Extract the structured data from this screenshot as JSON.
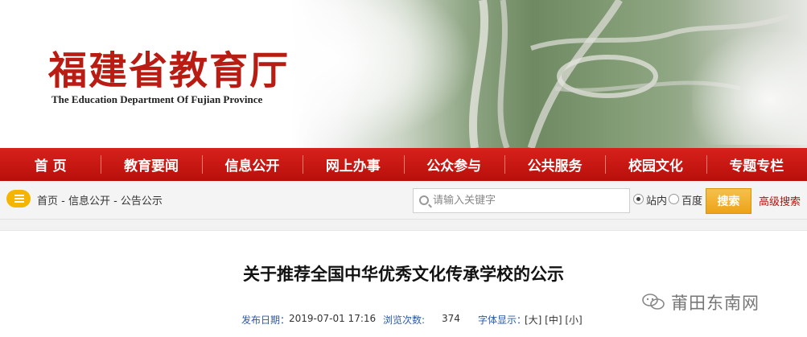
{
  "header": {
    "logo_cn": "福建省教育厅",
    "logo_en": "The Education Department Of Fujian Province"
  },
  "nav": {
    "items": [
      "首 页",
      "教育要闻",
      "信息公开",
      "网上办事",
      "公众参与",
      "公共服务",
      "校园文化",
      "专题专栏"
    ]
  },
  "breadcrumb": {
    "text": "首页 - 信息公开 - 公告公示"
  },
  "search": {
    "placeholder": "请输入关键字",
    "value": "",
    "option_site": "站内",
    "option_baidu": "百度",
    "selected": "站内",
    "button": "搜索",
    "advanced": "高级搜索"
  },
  "article": {
    "title": "关于推荐全国中华优秀文化传承学校的公示",
    "publish_label": "发布日期：",
    "publish_date": "2019-07-01 17:16",
    "views_label": "浏览次数:",
    "views": "374",
    "font_label": "字体显示：",
    "font_options": "[大] [中] [小]"
  },
  "watermark": {
    "text": "莆田东南网"
  },
  "colors": {
    "nav_red": "#c8160f",
    "logo_red": "#b81c12",
    "search_btn": "#f0aa22",
    "meta_blue": "#2a5aa8"
  }
}
